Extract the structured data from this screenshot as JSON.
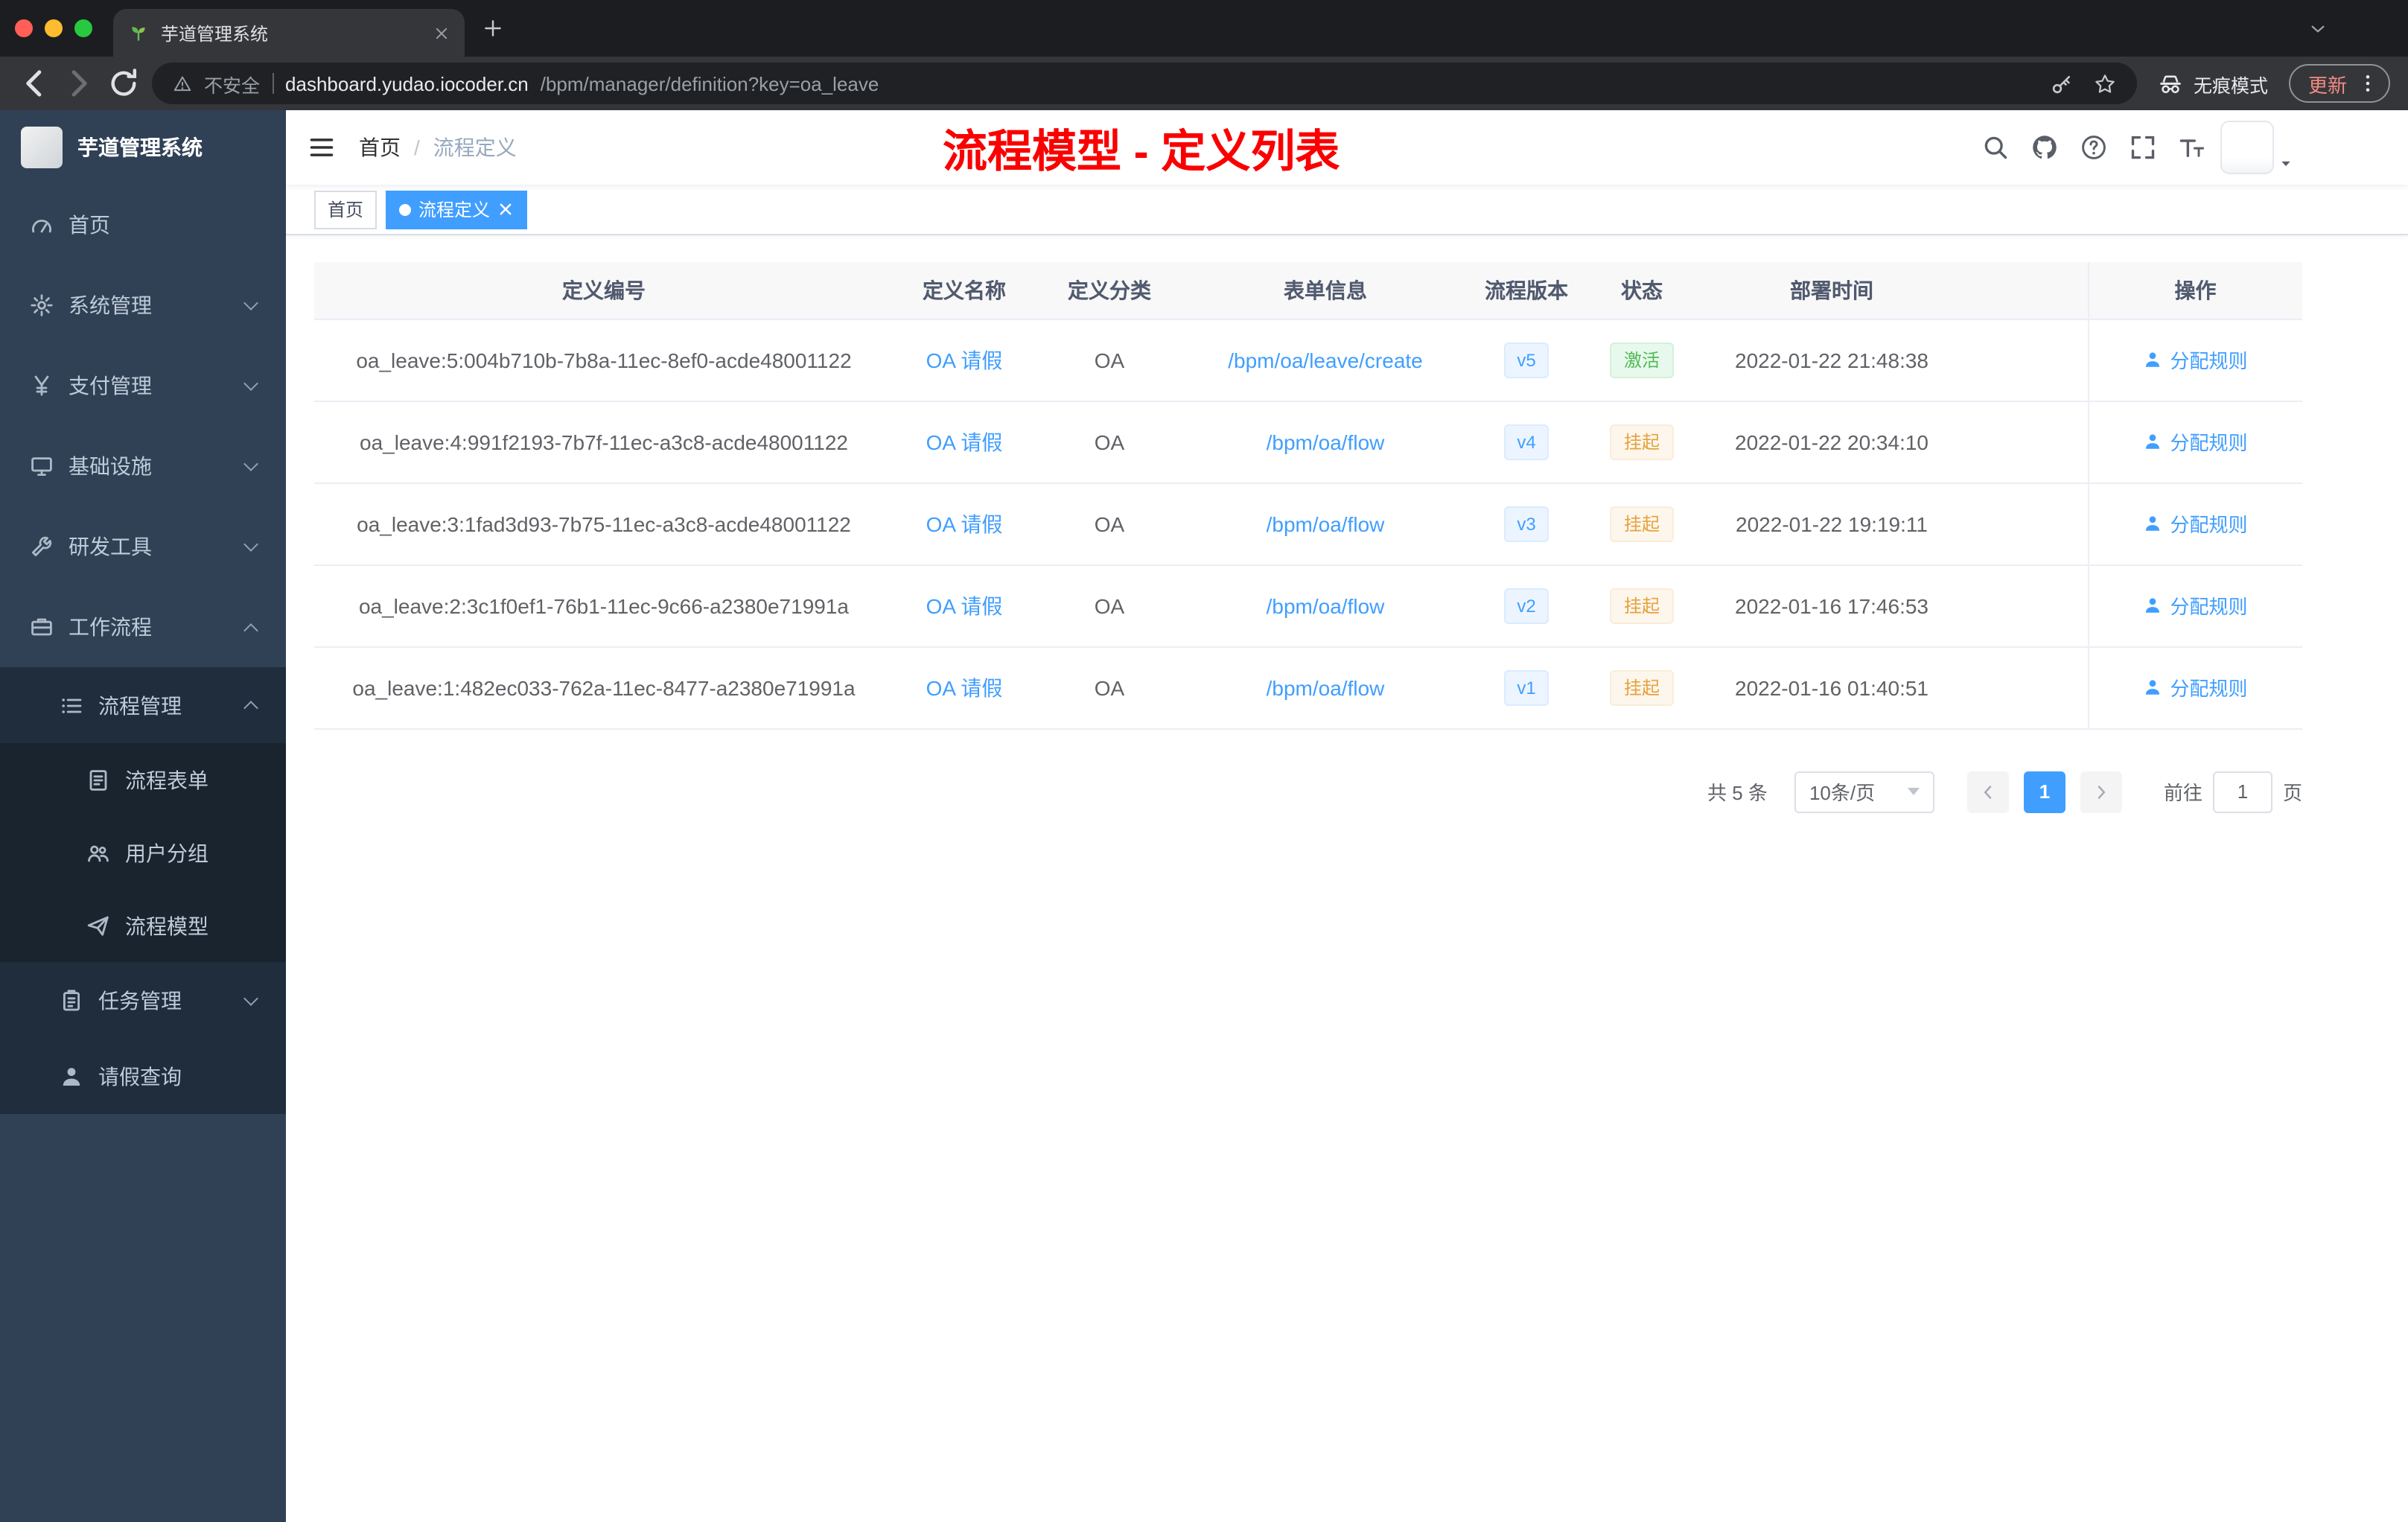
{
  "browser": {
    "tab": {
      "title": "芋道管理系统",
      "favicon": "sprout-icon"
    },
    "address": {
      "security_label": "不安全",
      "host": "dashboard.yudao.iocoder.cn",
      "path": "/bpm/manager/definition?key=oa_leave"
    },
    "incognito_label": "无痕模式",
    "update_label": "更新"
  },
  "sidebar": {
    "logo_title": "芋道管理系统",
    "menu": [
      {
        "label": "首页",
        "icon": "dashboard-icon",
        "level": 1,
        "chevron": ""
      },
      {
        "label": "系统管理",
        "icon": "gear-icon",
        "level": 1,
        "chevron": "down"
      },
      {
        "label": "支付管理",
        "icon": "yen-icon",
        "level": 1,
        "chevron": "down"
      },
      {
        "label": "基础设施",
        "icon": "monitor-icon",
        "level": 1,
        "chevron": "down"
      },
      {
        "label": "研发工具",
        "icon": "tool-icon",
        "level": 1,
        "chevron": "down"
      },
      {
        "label": "工作流程",
        "icon": "workflow-icon",
        "level": 1,
        "chevron": "up"
      },
      {
        "label": "流程管理",
        "icon": "list-icon",
        "level": 2,
        "chevron": "up"
      },
      {
        "label": "流程表单",
        "icon": "form-icon",
        "level": 3,
        "chevron": ""
      },
      {
        "label": "用户分组",
        "icon": "user-group-icon",
        "level": 3,
        "chevron": ""
      },
      {
        "label": "流程模型",
        "icon": "paper-plane-icon",
        "level": 3,
        "chevron": ""
      },
      {
        "label": "任务管理",
        "icon": "task-icon",
        "level": 2,
        "chevron": "down"
      },
      {
        "label": "请假查询",
        "icon": "person-icon",
        "level": 2,
        "chevron": ""
      }
    ]
  },
  "header": {
    "breadcrumb": [
      {
        "label": "首页"
      },
      {
        "label": "流程定义"
      }
    ],
    "overlay_title": "流程模型 - 定义列表",
    "action_icons": [
      {
        "icon": "search-icon"
      },
      {
        "icon": "github-icon"
      },
      {
        "icon": "question-icon"
      },
      {
        "icon": "fullscreen-icon"
      },
      {
        "icon": "font-size-icon"
      }
    ]
  },
  "tags": [
    {
      "label": "首页",
      "active": false,
      "closable": false
    },
    {
      "label": "流程定义",
      "active": true,
      "closable": true
    }
  ],
  "table": {
    "columns": [
      {
        "label": "定义编号"
      },
      {
        "label": "定义名称"
      },
      {
        "label": "定义分类"
      },
      {
        "label": "表单信息"
      },
      {
        "label": "流程版本"
      },
      {
        "label": "状态"
      },
      {
        "label": "部署时间"
      },
      {
        "label": "操作"
      }
    ],
    "rows": [
      {
        "id": "oa_leave:5:004b710b-7b8a-11ec-8ef0-acde48001122",
        "name": "OA 请假",
        "category": "OA",
        "form": "/bpm/oa/leave/create",
        "version": "v5",
        "status": "激活",
        "status_type": "success",
        "deploy_time": "2022-01-22 21:48:38",
        "action": "分配规则"
      },
      {
        "id": "oa_leave:4:991f2193-7b7f-11ec-a3c8-acde48001122",
        "name": "OA 请假",
        "category": "OA",
        "form": "/bpm/oa/flow",
        "version": "v4",
        "status": "挂起",
        "status_type": "warning",
        "deploy_time": "2022-01-22 20:34:10",
        "action": "分配规则"
      },
      {
        "id": "oa_leave:3:1fad3d93-7b75-11ec-a3c8-acde48001122",
        "name": "OA 请假",
        "category": "OA",
        "form": "/bpm/oa/flow",
        "version": "v3",
        "status": "挂起",
        "status_type": "warning",
        "deploy_time": "2022-01-22 19:19:11",
        "action": "分配规则"
      },
      {
        "id": "oa_leave:2:3c1f0ef1-76b1-11ec-9c66-a2380e71991a",
        "name": "OA 请假",
        "category": "OA",
        "form": "/bpm/oa/flow",
        "version": "v2",
        "status": "挂起",
        "status_type": "warning",
        "deploy_time": "2022-01-16 17:46:53",
        "action": "分配规则"
      },
      {
        "id": "oa_leave:1:482ec033-762a-11ec-8477-a2380e71991a",
        "name": "OA 请假",
        "category": "OA",
        "form": "/bpm/oa/flow",
        "version": "v1",
        "status": "挂起",
        "status_type": "warning",
        "deploy_time": "2022-01-16 01:40:51",
        "action": "分配规则"
      }
    ]
  },
  "pagination": {
    "total_label": "共 5 条",
    "page_size_label": "10条/页",
    "current_page": "1",
    "goto_label": "前往",
    "goto_value": "1",
    "goto_unit": "页"
  }
}
